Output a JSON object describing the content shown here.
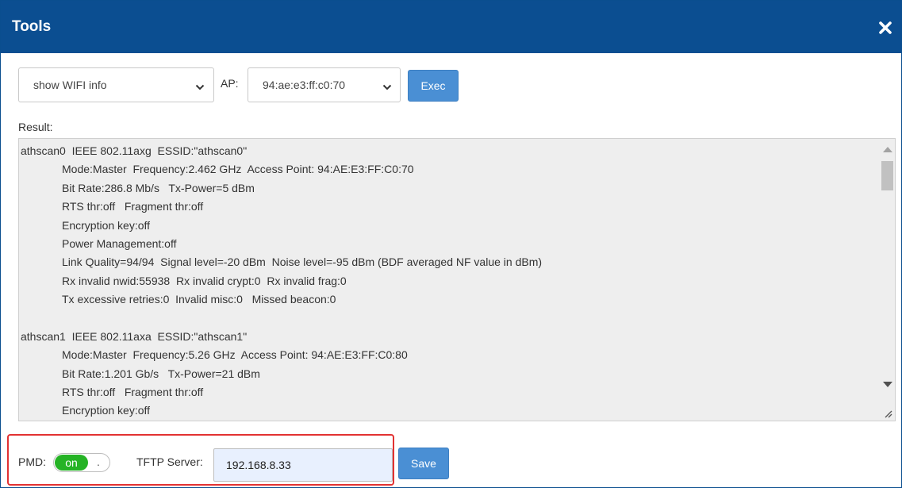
{
  "dialog": {
    "title": "Tools"
  },
  "controls": {
    "command_select": "show WIFI info",
    "ap_label": "AP:",
    "ap_select": "94:ae:e3:ff:c0:70",
    "exec_label": "Exec"
  },
  "result": {
    "label": "Result:",
    "lines": [
      {
        "text": "athscan0  IEEE 802.11axg  ESSID:\"athscan0\"",
        "indent": false
      },
      {
        "text": "Mode:Master  Frequency:2.462 GHz  Access Point: 94:AE:E3:FF:C0:70",
        "indent": true
      },
      {
        "text": "Bit Rate:286.8 Mb/s   Tx-Power=5 dBm",
        "indent": true
      },
      {
        "text": "RTS thr:off   Fragment thr:off",
        "indent": true
      },
      {
        "text": "Encryption key:off",
        "indent": true
      },
      {
        "text": "Power Management:off",
        "indent": true
      },
      {
        "text": "Link Quality=94/94  Signal level=-20 dBm  Noise level=-95 dBm (BDF averaged NF value in dBm)",
        "indent": true
      },
      {
        "text": "Rx invalid nwid:55938  Rx invalid crypt:0  Rx invalid frag:0",
        "indent": true
      },
      {
        "text": "Tx excessive retries:0  Invalid misc:0   Missed beacon:0",
        "indent": true
      },
      {
        "text": "",
        "indent": false
      },
      {
        "text": "athscan1  IEEE 802.11axa  ESSID:\"athscan1\"",
        "indent": false
      },
      {
        "text": "Mode:Master  Frequency:5.26 GHz  Access Point: 94:AE:E3:FF:C0:80",
        "indent": true
      },
      {
        "text": "Bit Rate:1.201 Gb/s   Tx-Power=21 dBm",
        "indent": true
      },
      {
        "text": "RTS thr:off   Fragment thr:off",
        "indent": true
      },
      {
        "text": "Encryption key:off",
        "indent": true
      }
    ]
  },
  "footer": {
    "pmd_label": "PMD:",
    "pmd_toggle_on": "on",
    "pmd_toggle_knob": ".",
    "tftp_label": "TFTP Server:",
    "tftp_value": "192.168.8.33",
    "save_label": "Save"
  },
  "icons": {
    "close": "close-icon",
    "chevron": "chevron-down-icon"
  },
  "colors": {
    "titlebar": "#0b4e91",
    "button": "#4a8fd4",
    "toggle_on": "#25b325",
    "highlight": "#e23232",
    "result_bg": "#eeeeee",
    "input_autofill_bg": "#e8f0fe"
  }
}
